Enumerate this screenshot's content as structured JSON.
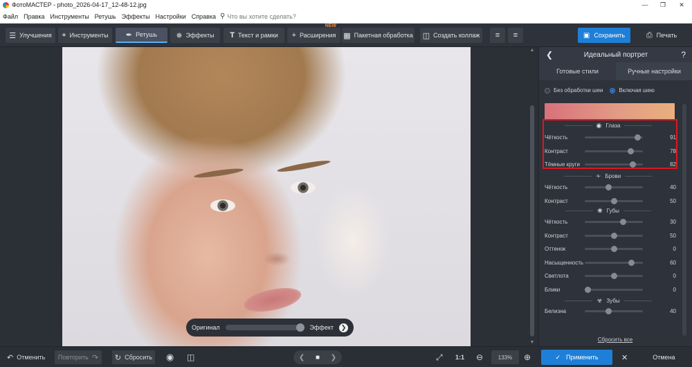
{
  "titlebar": {
    "title": "ФотоМАСТЕР - photo_2026-04-17_12-48-12.jpg",
    "minimize": "—",
    "restore": "❐",
    "close": "✕"
  },
  "menu": {
    "items": [
      "Файл",
      "Правка",
      "Инструменты",
      "Ретушь",
      "Эффекты",
      "Настройки",
      "Справка"
    ],
    "search_placeholder": "Что вы хотите сделать?"
  },
  "toolbar": {
    "improvements": "Улучшения",
    "tools": "Инструменты",
    "retouch": "Ретушь",
    "effects": "Эффекты",
    "text_frames": "Текст и рамки",
    "extensions": "Расширения",
    "extensions_badge": "NEW",
    "batch": "Пакетная обработка",
    "collage": "Создать коллаж",
    "save": "Сохранить",
    "print": "Печать"
  },
  "compare": {
    "original": "Оригинал",
    "effect": "Эффект",
    "position": 0.95
  },
  "panel": {
    "title": "Идеальный портрет",
    "tabs": [
      "Готовые стили",
      "Ручные настройки"
    ],
    "active_tab": 1,
    "radio_no_neck": "Без обработки шеи",
    "radio_with_neck": "Включая шею",
    "radio_selected": "with_neck",
    "sections": {
      "eyes": "Глаза",
      "brows": "Брови",
      "lips": "Губы",
      "teeth": "Зубы"
    },
    "sliders": {
      "eyes_clarity": {
        "label": "Чёткость",
        "value": "91",
        "pos": 0.91
      },
      "eyes_contrast": {
        "label": "Контраст",
        "value": "78",
        "pos": 0.78
      },
      "eyes_dark_circles": {
        "label": "Тёмные круги",
        "value": "82",
        "pos": 0.82
      },
      "brows_clarity": {
        "label": "Чёткость",
        "value": "40",
        "pos": 0.4
      },
      "brows_contrast": {
        "label": "Контраст",
        "value": "50",
        "pos": 0.5
      },
      "lips_clarity": {
        "label": "Чёткость",
        "value": "30",
        "pos": 0.65
      },
      "lips_contrast": {
        "label": "Контраст",
        "value": "50",
        "pos": 0.5
      },
      "lips_tone": {
        "label": "Оттенок",
        "value": "0",
        "pos": 0.5
      },
      "lips_saturation": {
        "label": "Насыщенность",
        "value": "60",
        "pos": 0.8
      },
      "lips_lightness": {
        "label": "Светлота",
        "value": "0",
        "pos": 0.5
      },
      "lips_gloss": {
        "label": "Блики",
        "value": "0",
        "pos": 0.05
      },
      "teeth_white": {
        "label": "Белизна",
        "value": "40",
        "pos": 0.4
      }
    },
    "reset_all": "Сбросить все"
  },
  "statusbar": {
    "undo": "Отменить",
    "redo": "Повторить",
    "reset": "Сбросить",
    "ratio": "1:1",
    "zoom": "133%",
    "apply": "Применить",
    "cancel": "Отмена"
  },
  "colors": {
    "accent": "#1e7fd8",
    "highlight": "#e0171b"
  }
}
